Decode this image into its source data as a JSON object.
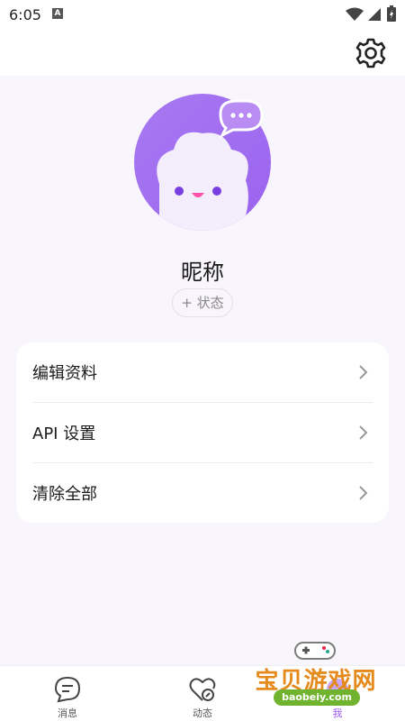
{
  "status_bar": {
    "time": "6:05",
    "notification_icon": "a-icon",
    "wifi_icon": "wifi-icon",
    "signal_icon": "signal-icon",
    "battery_icon": "battery-charging-icon"
  },
  "top_bar": {
    "settings_icon": "gear-icon"
  },
  "profile": {
    "avatar_icon": "cloud-mascot-chat-avatar",
    "nickname": "昵称",
    "status_chip": "+ 状态"
  },
  "menu": {
    "items": [
      {
        "label": "编辑资料"
      },
      {
        "label": "API 设置"
      },
      {
        "label": "清除全部"
      }
    ]
  },
  "tabs": [
    {
      "label": "消息",
      "icon": "message-icon"
    },
    {
      "label": "动态",
      "icon": "moments-icon"
    },
    {
      "label": "我",
      "icon": "me-icon"
    }
  ],
  "watermark": {
    "text": "宝贝游戏网",
    "url": "baobeiy.com"
  },
  "colors": {
    "background": "#f8f5fc",
    "avatar_purple": "#a777f0",
    "accent": "#9b5cf0",
    "card": "#ffffff"
  }
}
